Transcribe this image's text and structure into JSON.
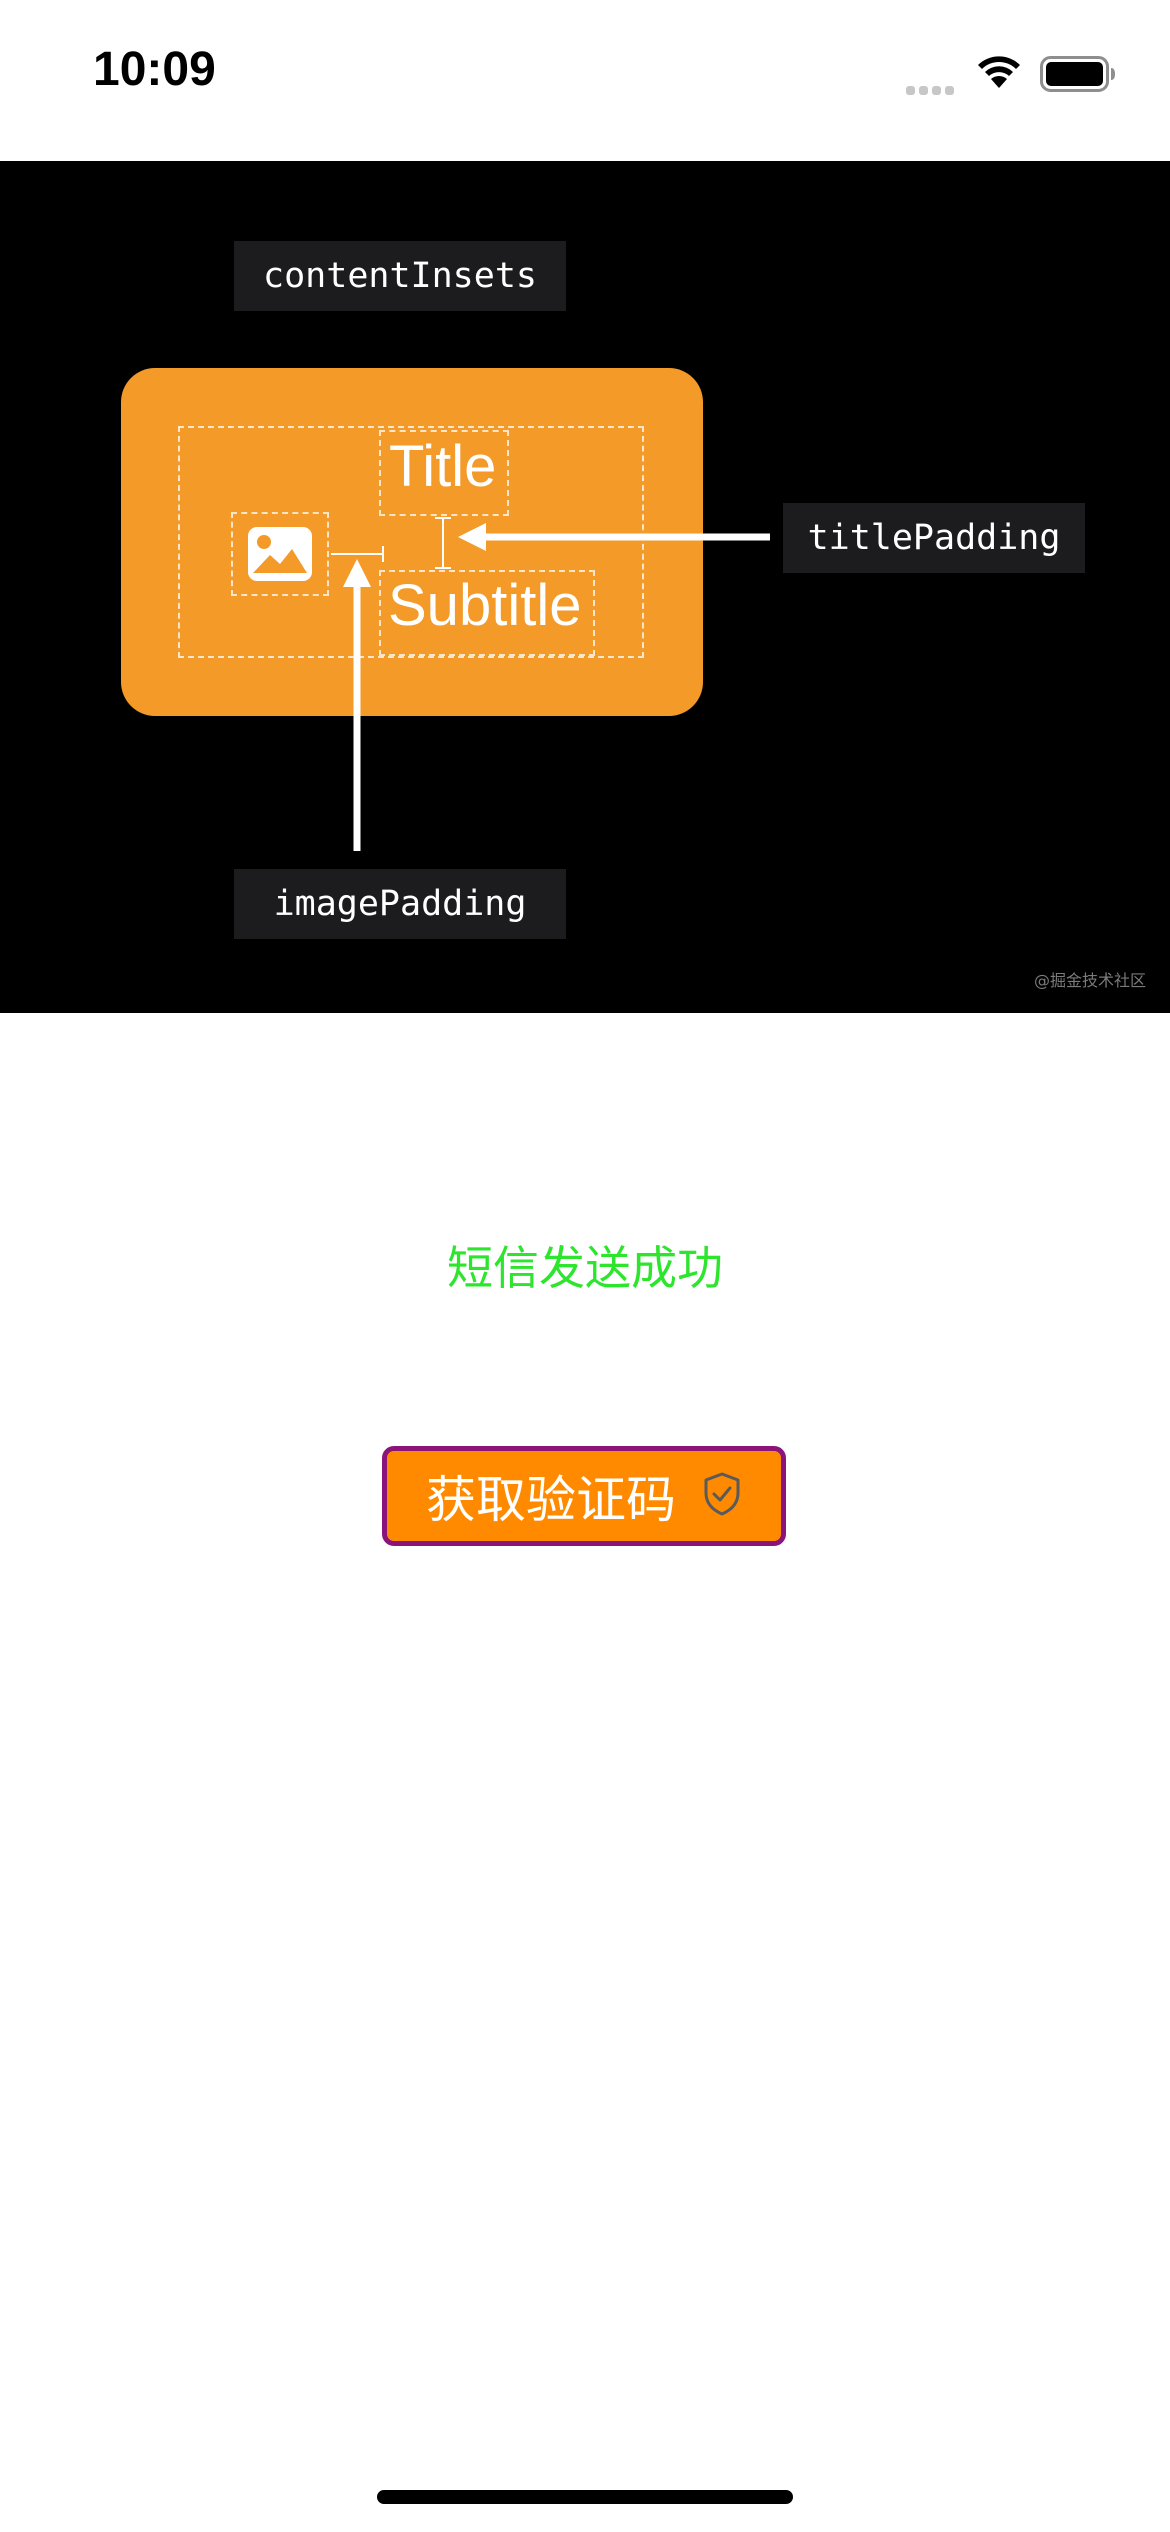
{
  "status_bar": {
    "time": "10:09",
    "signal_icon": "cellular-signal-dots",
    "wifi_icon": "wifi",
    "battery_icon": "battery-full"
  },
  "banner": {
    "content_insets_label": "contentInsets",
    "title_padding_label": "titlePadding",
    "image_padding_label": "imagePadding",
    "card_title": "Title",
    "card_subtitle": "Subtitle",
    "card_icon": "photo",
    "watermark": "@掘金技术社区",
    "accent_color": "#f39a28"
  },
  "main": {
    "sms_status": "短信发送成功",
    "sms_status_color": "#2ee52e",
    "verify_button_label": "获取验证码",
    "verify_button_icon": "shield-check",
    "verify_button_color": "#ff8a00",
    "verify_button_border_color": "#8a147a"
  }
}
